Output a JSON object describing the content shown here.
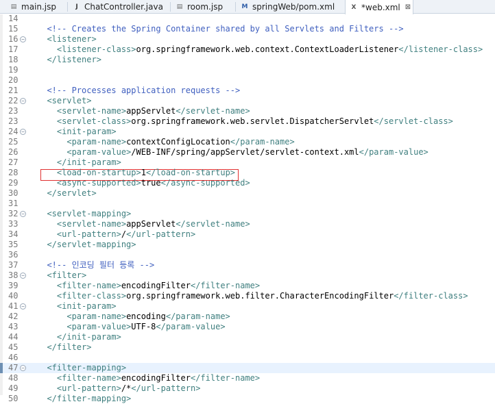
{
  "tabs": [
    {
      "label": "main.jsp",
      "icon": "jsp-file-icon",
      "active": false
    },
    {
      "label": "ChatController.java",
      "icon": "java-file-icon",
      "active": false
    },
    {
      "label": "room.jsp",
      "icon": "jsp-file-icon",
      "active": false
    },
    {
      "label": "springWeb/pom.xml",
      "icon": "maven-pom-icon",
      "active": false
    },
    {
      "label": "*web.xml",
      "icon": "xml-file-icon",
      "active": true,
      "close": "⊠"
    }
  ],
  "lines": [
    {
      "n": "14",
      "fold": "",
      "parts": []
    },
    {
      "n": "15",
      "fold": "",
      "parts": [
        {
          "t": "  ",
          "c": "text"
        },
        {
          "t": "<!-- Creates the Spring Container shared by all Servlets and Filters -->",
          "c": "comment"
        }
      ]
    },
    {
      "n": "16",
      "fold": "⊖",
      "parts": [
        {
          "t": "  ",
          "c": "text"
        },
        {
          "t": "<listener>",
          "c": "tag"
        }
      ]
    },
    {
      "n": "17",
      "fold": "",
      "parts": [
        {
          "t": "    ",
          "c": "text"
        },
        {
          "t": "<listener-class>",
          "c": "tag"
        },
        {
          "t": "org.springframework.web.context.ContextLoaderListener",
          "c": "text"
        },
        {
          "t": "</listener-class>",
          "c": "tag"
        }
      ]
    },
    {
      "n": "18",
      "fold": "",
      "parts": [
        {
          "t": "  ",
          "c": "text"
        },
        {
          "t": "</listener>",
          "c": "tag"
        }
      ]
    },
    {
      "n": "19",
      "fold": "",
      "parts": []
    },
    {
      "n": "20",
      "fold": "",
      "parts": []
    },
    {
      "n": "21",
      "fold": "",
      "parts": [
        {
          "t": "  ",
          "c": "text"
        },
        {
          "t": "<!-- Processes application requests -->",
          "c": "comment"
        }
      ]
    },
    {
      "n": "22",
      "fold": "⊖",
      "parts": [
        {
          "t": "  ",
          "c": "text"
        },
        {
          "t": "<servlet>",
          "c": "tag"
        }
      ]
    },
    {
      "n": "23",
      "fold": "",
      "parts": [
        {
          "t": "    ",
          "c": "text"
        },
        {
          "t": "<servlet-name>",
          "c": "tag"
        },
        {
          "t": "appServlet",
          "c": "text"
        },
        {
          "t": "</servlet-name>",
          "c": "tag"
        }
      ]
    },
    {
      "n": "23",
      "fold": "",
      "parts": [
        {
          "t": "    ",
          "c": "text"
        },
        {
          "t": "<servlet-class>",
          "c": "tag"
        },
        {
          "t": "org.springframework.web.servlet.DispatcherServlet",
          "c": "text"
        },
        {
          "t": "</servlet-class>",
          "c": "tag"
        }
      ]
    },
    {
      "n": "24",
      "fold": "⊖",
      "parts": [
        {
          "t": "    ",
          "c": "text"
        },
        {
          "t": "<init-param>",
          "c": "tag"
        }
      ]
    },
    {
      "n": "25",
      "fold": "",
      "parts": [
        {
          "t": "      ",
          "c": "text"
        },
        {
          "t": "<param-name>",
          "c": "tag"
        },
        {
          "t": "contextConfigLocation",
          "c": "text"
        },
        {
          "t": "</param-name>",
          "c": "tag"
        }
      ]
    },
    {
      "n": "26",
      "fold": "",
      "parts": [
        {
          "t": "      ",
          "c": "text"
        },
        {
          "t": "<param-value>",
          "c": "tag"
        },
        {
          "t": "/WEB-INF/spring/appServlet/servlet-context.xml",
          "c": "text"
        },
        {
          "t": "</param-value>",
          "c": "tag"
        }
      ]
    },
    {
      "n": "27",
      "fold": "",
      "parts": [
        {
          "t": "    ",
          "c": "text"
        },
        {
          "t": "</init-param>",
          "c": "tag"
        }
      ]
    },
    {
      "n": "28",
      "fold": "",
      "parts": [
        {
          "t": "    ",
          "c": "text"
        },
        {
          "t": "<load-on-startup>",
          "c": "tag"
        },
        {
          "t": "1",
          "c": "text"
        },
        {
          "t": "</load-on-startup>",
          "c": "tag"
        }
      ]
    },
    {
      "n": "29",
      "fold": "",
      "parts": [
        {
          "t": "    ",
          "c": "text"
        },
        {
          "t": "<async-supported>",
          "c": "tag"
        },
        {
          "t": "true",
          "c": "text"
        },
        {
          "t": "</async-supported>",
          "c": "tag"
        }
      ]
    },
    {
      "n": "30",
      "fold": "",
      "parts": [
        {
          "t": "  ",
          "c": "text"
        },
        {
          "t": "</servlet>",
          "c": "tag"
        }
      ]
    },
    {
      "n": "31",
      "fold": "",
      "parts": []
    },
    {
      "n": "32",
      "fold": "⊖",
      "parts": [
        {
          "t": "  ",
          "c": "text"
        },
        {
          "t": "<servlet-mapping>",
          "c": "tag"
        }
      ]
    },
    {
      "n": "33",
      "fold": "",
      "parts": [
        {
          "t": "    ",
          "c": "text"
        },
        {
          "t": "<servlet-name>",
          "c": "tag"
        },
        {
          "t": "appServlet",
          "c": "text"
        },
        {
          "t": "</servlet-name>",
          "c": "tag"
        }
      ]
    },
    {
      "n": "34",
      "fold": "",
      "parts": [
        {
          "t": "    ",
          "c": "text"
        },
        {
          "t": "<url-pattern>",
          "c": "tag"
        },
        {
          "t": "/",
          "c": "text"
        },
        {
          "t": "</url-pattern>",
          "c": "tag"
        }
      ]
    },
    {
      "n": "35",
      "fold": "",
      "parts": [
        {
          "t": "  ",
          "c": "text"
        },
        {
          "t": "</servlet-mapping>",
          "c": "tag"
        }
      ]
    },
    {
      "n": "36",
      "fold": "",
      "parts": []
    },
    {
      "n": "37",
      "fold": "",
      "parts": [
        {
          "t": "  ",
          "c": "text"
        },
        {
          "t": "<!-- 인코딩 필터 등록 -->",
          "c": "comment"
        }
      ]
    },
    {
      "n": "38",
      "fold": "⊖",
      "parts": [
        {
          "t": "  ",
          "c": "text"
        },
        {
          "t": "<filter>",
          "c": "tag"
        }
      ]
    },
    {
      "n": "39",
      "fold": "",
      "parts": [
        {
          "t": "    ",
          "c": "text"
        },
        {
          "t": "<filter-name>",
          "c": "tag"
        },
        {
          "t": "encodingFilter",
          "c": "text"
        },
        {
          "t": "</filter-name>",
          "c": "tag"
        }
      ]
    },
    {
      "n": "40",
      "fold": "",
      "parts": [
        {
          "t": "    ",
          "c": "text"
        },
        {
          "t": "<filter-class>",
          "c": "tag"
        },
        {
          "t": "org.springframework.web.filter.CharacterEncodingFilter",
          "c": "text"
        },
        {
          "t": "</filter-class>",
          "c": "tag"
        }
      ]
    },
    {
      "n": "41",
      "fold": "⊖",
      "parts": [
        {
          "t": "    ",
          "c": "text"
        },
        {
          "t": "<init-param>",
          "c": "tag"
        }
      ]
    },
    {
      "n": "42",
      "fold": "",
      "parts": [
        {
          "t": "      ",
          "c": "text"
        },
        {
          "t": "<param-name>",
          "c": "tag"
        },
        {
          "t": "encoding",
          "c": "text"
        },
        {
          "t": "</param-name>",
          "c": "tag"
        }
      ]
    },
    {
      "n": "43",
      "fold": "",
      "parts": [
        {
          "t": "      ",
          "c": "text"
        },
        {
          "t": "<param-value>",
          "c": "tag"
        },
        {
          "t": "UTF-8",
          "c": "text"
        },
        {
          "t": "</param-value>",
          "c": "tag"
        }
      ]
    },
    {
      "n": "44",
      "fold": "",
      "parts": [
        {
          "t": "    ",
          "c": "text"
        },
        {
          "t": "</init-param>",
          "c": "tag"
        }
      ]
    },
    {
      "n": "45",
      "fold": "",
      "parts": [
        {
          "t": "  ",
          "c": "text"
        },
        {
          "t": "</filter>",
          "c": "tag"
        }
      ]
    },
    {
      "n": "46",
      "fold": "",
      "parts": []
    },
    {
      "n": "47",
      "fold": "⊖",
      "current": true,
      "parts": [
        {
          "t": "  ",
          "c": "text"
        },
        {
          "t": "<filter-mapping>",
          "c": "tag"
        }
      ]
    },
    {
      "n": "48",
      "fold": "",
      "parts": [
        {
          "t": "    ",
          "c": "text"
        },
        {
          "t": "<filter-name>",
          "c": "tag"
        },
        {
          "t": "encodingFilter",
          "c": "text"
        },
        {
          "t": "</filter-name>",
          "c": "tag"
        }
      ]
    },
    {
      "n": "49",
      "fold": "",
      "parts": [
        {
          "t": "    ",
          "c": "text"
        },
        {
          "t": "<url-pattern>",
          "c": "tag"
        },
        {
          "t": "/*",
          "c": "text"
        },
        {
          "t": "</url-pattern>",
          "c": "tag"
        }
      ]
    },
    {
      "n": "50",
      "fold": "",
      "parts": [
        {
          "t": "  ",
          "c": "text"
        },
        {
          "t": "</filter-mapping>",
          "c": "tag"
        }
      ]
    }
  ],
  "colors": {
    "comment": "#3f5fbf",
    "tag": "#3f7f7f",
    "text": "#000000",
    "highlight_box": "#e03030",
    "current_line": "#e8f2fe"
  }
}
